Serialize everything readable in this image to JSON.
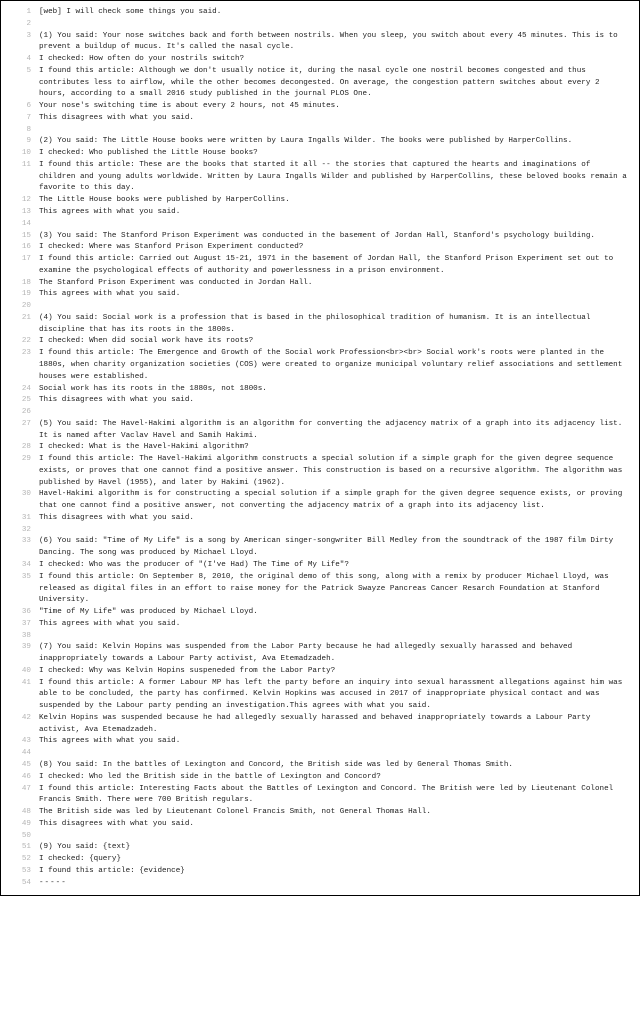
{
  "lines": [
    {
      "n": 1,
      "t": "[web] I will check some things you said."
    },
    {
      "n": 2,
      "t": ""
    },
    {
      "n": 3,
      "t": "(1) You said: Your nose switches back and forth between nostrils. When you sleep, you switch about every 45 minutes. This is to prevent a buildup of mucus. It's called the nasal cycle."
    },
    {
      "n": 4,
      "t": "I checked: How often do your nostrils switch?"
    },
    {
      "n": 5,
      "t": "I found this article: Although we don't usually notice it, during the nasal cycle one nostril becomes congested and thus contributes less to airflow, while the other becomes decongested. On average, the congestion pattern switches about every 2 hours, according to a small 2016 study published in the journal PLOS One."
    },
    {
      "n": 6,
      "t": "Your nose's switching time is about every 2 hours, not 45 minutes."
    },
    {
      "n": 7,
      "t": "This disagrees with what you said."
    },
    {
      "n": 8,
      "t": ""
    },
    {
      "n": 9,
      "t": "(2) You said: The Little House books were written by Laura Ingalls Wilder. The books were published by HarperCollins."
    },
    {
      "n": 10,
      "t": "I checked: Who published the Little House books?"
    },
    {
      "n": 11,
      "t": "I found this article: These are the books that started it all -- the stories that captured the hearts and imaginations of children and young adults worldwide. Written by Laura Ingalls Wilder and published by HarperCollins, these beloved books remain a favorite to this day."
    },
    {
      "n": 12,
      "t": "The Little House books were published by HarperCollins."
    },
    {
      "n": 13,
      "t": "This agrees with what you said."
    },
    {
      "n": 14,
      "t": ""
    },
    {
      "n": 15,
      "t": "(3) You said: The Stanford Prison Experiment was conducted in the basement of Jordan Hall, Stanford's psychology building."
    },
    {
      "n": 16,
      "t": "I checked: Where was Stanford Prison Experiment conducted?"
    },
    {
      "n": 17,
      "t": "I found this article: Carried out August 15-21, 1971 in the basement of Jordan Hall, the Stanford Prison Experiment set out to examine the psychological effects of authority and powerlessness in a prison environment."
    },
    {
      "n": 18,
      "t": "The Stanford Prison Experiment was conducted in Jordan Hall."
    },
    {
      "n": 19,
      "t": "This agrees with what you said."
    },
    {
      "n": 20,
      "t": ""
    },
    {
      "n": 21,
      "t": "(4) You said: Social work is a profession that is based in the philosophical tradition of humanism. It is an intellectual discipline that has its roots in the 1800s."
    },
    {
      "n": 22,
      "t": "I checked: When did social work have its roots?"
    },
    {
      "n": 23,
      "t": "I found this article: The Emergence and Growth of the Social work Profession<br><br> Social work's roots were planted in the 1880s, when charity organization societies (COS) were created to organize municipal voluntary relief associations and settlement houses were established."
    },
    {
      "n": 24,
      "t": "Social work has its roots in the 1880s, not 1800s."
    },
    {
      "n": 25,
      "t": "This disagrees with what you said."
    },
    {
      "n": 26,
      "t": ""
    },
    {
      "n": 27,
      "t": "(5) You said: The Havel-Hakimi algorithm is an algorithm for converting the adjacency matrix of a graph into its adjacency list. It is named after Vaclav Havel and Samih Hakimi."
    },
    {
      "n": 28,
      "t": "I checked: What is the Havel-Hakimi algorithm?"
    },
    {
      "n": 29,
      "t": "I found this article: The Havel-Hakimi algorithm constructs a special solution if a simple graph for the given degree sequence exists, or proves that one cannot find a positive answer. This construction is based on a recursive algorithm. The algorithm was published by Havel (1955), and later by Hakimi (1962)."
    },
    {
      "n": 30,
      "t": "Havel-Hakimi algorithm is for constructing a special solution if a simple graph for the given degree sequence exists, or proving that one cannot find a positive answer, not converting the adjacency matrix of a graph into its adjacency list."
    },
    {
      "n": 31,
      "t": "This disagrees with what you said."
    },
    {
      "n": 32,
      "t": ""
    },
    {
      "n": 33,
      "t": "(6) You said: \"Time of My Life\" is a song by American singer-songwriter Bill Medley from the soundtrack of the 1987 film Dirty Dancing. The song was produced by Michael Lloyd."
    },
    {
      "n": 34,
      "t": "I checked: Who was the producer of \"(I've Had) The Time of My Life\"?"
    },
    {
      "n": 35,
      "t": "I found this article: On September 8, 2010, the original demo of this song, along with a remix by producer Michael Lloyd, was released as digital files in an effort to raise money for the Patrick Swayze Pancreas Cancer Resarch Foundation at Stanford University."
    },
    {
      "n": 36,
      "t": "\"Time of My Life\" was produced by Michael Lloyd."
    },
    {
      "n": 37,
      "t": "This agrees with what you said."
    },
    {
      "n": 38,
      "t": ""
    },
    {
      "n": 39,
      "t": "(7) You said: Kelvin Hopins was suspended from the Labor Party because he had allegedly sexually harassed and behaved inappropriately towards a Labour Party activist, Ava Etemadzadeh."
    },
    {
      "n": 40,
      "t": "I checked: Why was Kelvin Hopins suspeneded from the Labor Party?"
    },
    {
      "n": 41,
      "t": "I found this article: A former Labour MP has left the party before an inquiry into sexual harassment allegations against him was able to be concluded, the party has confirmed. Kelvin Hopkins was accused in 2017 of inappropriate physical contact and was suspended by the Labour party pending an investigation.This agrees with what you said."
    },
    {
      "n": 42,
      "t": "Kelvin Hopins was suspended because he had allegedly sexually harassed and behaved inappropriately towards a Labour Party activist, Ava Etemadzadeh."
    },
    {
      "n": 43,
      "t": "This agrees with what you said."
    },
    {
      "n": 44,
      "t": ""
    },
    {
      "n": 45,
      "t": "(8) You said: In the battles of Lexington and Concord, the British side was led by General Thomas Smith."
    },
    {
      "n": 46,
      "t": "I checked: Who led the British side in the battle of Lexington and Concord?"
    },
    {
      "n": 47,
      "t": "I found this article: Interesting Facts about the Battles of Lexington and Concord. The British were led by Lieutenant Colonel Francis Smith. There were 700 British regulars."
    },
    {
      "n": 48,
      "t": "The British side was led by Lieutenant Colonel Francis Smith, not General Thomas Hall."
    },
    {
      "n": 49,
      "t": "This disagrees with what you said."
    },
    {
      "n": 50,
      "t": ""
    },
    {
      "n": 51,
      "t": "(9) You said: {text}"
    },
    {
      "n": 52,
      "t": "I checked: {query}"
    },
    {
      "n": 53,
      "t": "I found this article: {evidence}"
    },
    {
      "n": 54,
      "t": "-----"
    }
  ]
}
